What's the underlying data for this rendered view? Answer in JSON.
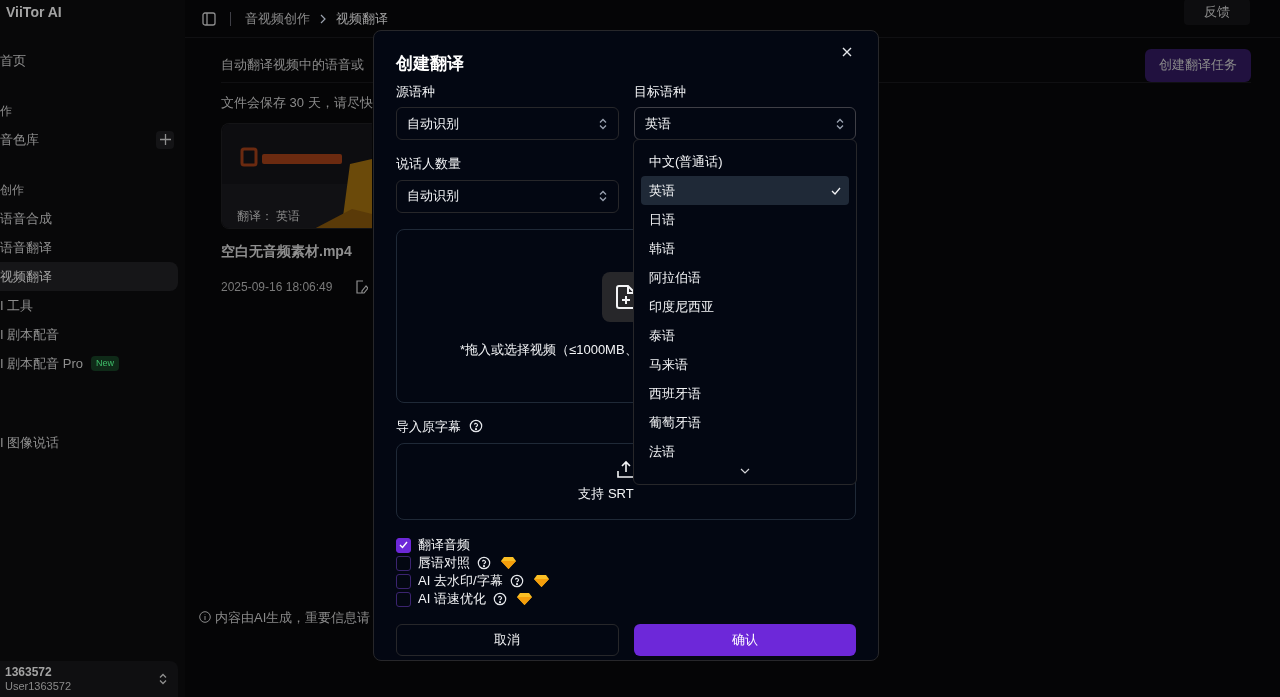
{
  "sidebar": {
    "brand": "ViiTor AI",
    "sections": [
      {
        "items": [
          {
            "kind": "item",
            "label": "首页",
            "selected": false
          }
        ]
      },
      {
        "heading": "作",
        "items": [
          {
            "kind": "item_add",
            "label": "音色库",
            "selected": false
          }
        ]
      },
      {
        "heading": "创作",
        "items": [
          {
            "kind": "item",
            "label": "语音合成",
            "selected": false
          },
          {
            "kind": "item",
            "label": "语音翻译",
            "selected": false
          },
          {
            "kind": "item",
            "label": "视频翻译",
            "selected": true
          },
          {
            "kind": "item",
            "label": "I 工具",
            "selected": false
          },
          {
            "kind": "item",
            "label": "I 剧本配音",
            "selected": false
          },
          {
            "kind": "item",
            "label": "I 剧本配音 Pro",
            "selected": false,
            "badge": "New"
          }
        ]
      },
      {
        "items": [
          {
            "kind": "item",
            "label": "I 图像说话",
            "selected": false
          }
        ]
      }
    ],
    "user": {
      "name": "1363572",
      "id": "User1363572"
    }
  },
  "topbar": {
    "breadcrumb": [
      "音视频创作",
      "视频翻译"
    ],
    "feedback": "反馈"
  },
  "content": {
    "description": "自动翻译视频中的语音或",
    "notice": "文件会保存 30 天，请尽快",
    "create_button": "创建翻译任务",
    "card": {
      "tag": "翻译： 英语",
      "title": "空白无音频素材.mp4",
      "date": "2025-09-16 18:06:49"
    },
    "footer": "内容由AI生成，重要信息请"
  },
  "modal": {
    "title": "创建翻译",
    "source": {
      "label": "源语种",
      "value": "自动识别"
    },
    "target": {
      "label": "目标语种",
      "value": "英语",
      "expanded": true,
      "options": [
        {
          "label": "中文(普通话)",
          "selected": false
        },
        {
          "label": "英语",
          "selected": true
        },
        {
          "label": "日语",
          "selected": false
        },
        {
          "label": "韩语",
          "selected": false
        },
        {
          "label": "阿拉伯语",
          "selected": false
        },
        {
          "label": "印度尼西亚",
          "selected": false
        },
        {
          "label": "泰语",
          "selected": false
        },
        {
          "label": "马来语",
          "selected": false
        },
        {
          "label": "西班牙语",
          "selected": false
        },
        {
          "label": "葡萄牙语",
          "selected": false
        },
        {
          "label": "法语",
          "selected": false
        }
      ]
    },
    "speakers": {
      "label": "说话人数量",
      "value": "自动识别"
    },
    "video_upload": {
      "text": "*拖入或选择视频（≤1000MB、"
    },
    "subtitle": {
      "label": "导入原字幕",
      "text": "支持 SRT"
    },
    "options": [
      {
        "label": "翻译音频",
        "checked": true,
        "help": false,
        "premium": false
      },
      {
        "label": "唇语对照",
        "checked": false,
        "help": true,
        "premium": true
      },
      {
        "label": "AI 去水印/字幕",
        "checked": false,
        "help": true,
        "premium": true
      },
      {
        "label": "AI 语速优化",
        "checked": false,
        "help": true,
        "premium": true
      }
    ],
    "cancel": "取消",
    "confirm": "确认"
  }
}
